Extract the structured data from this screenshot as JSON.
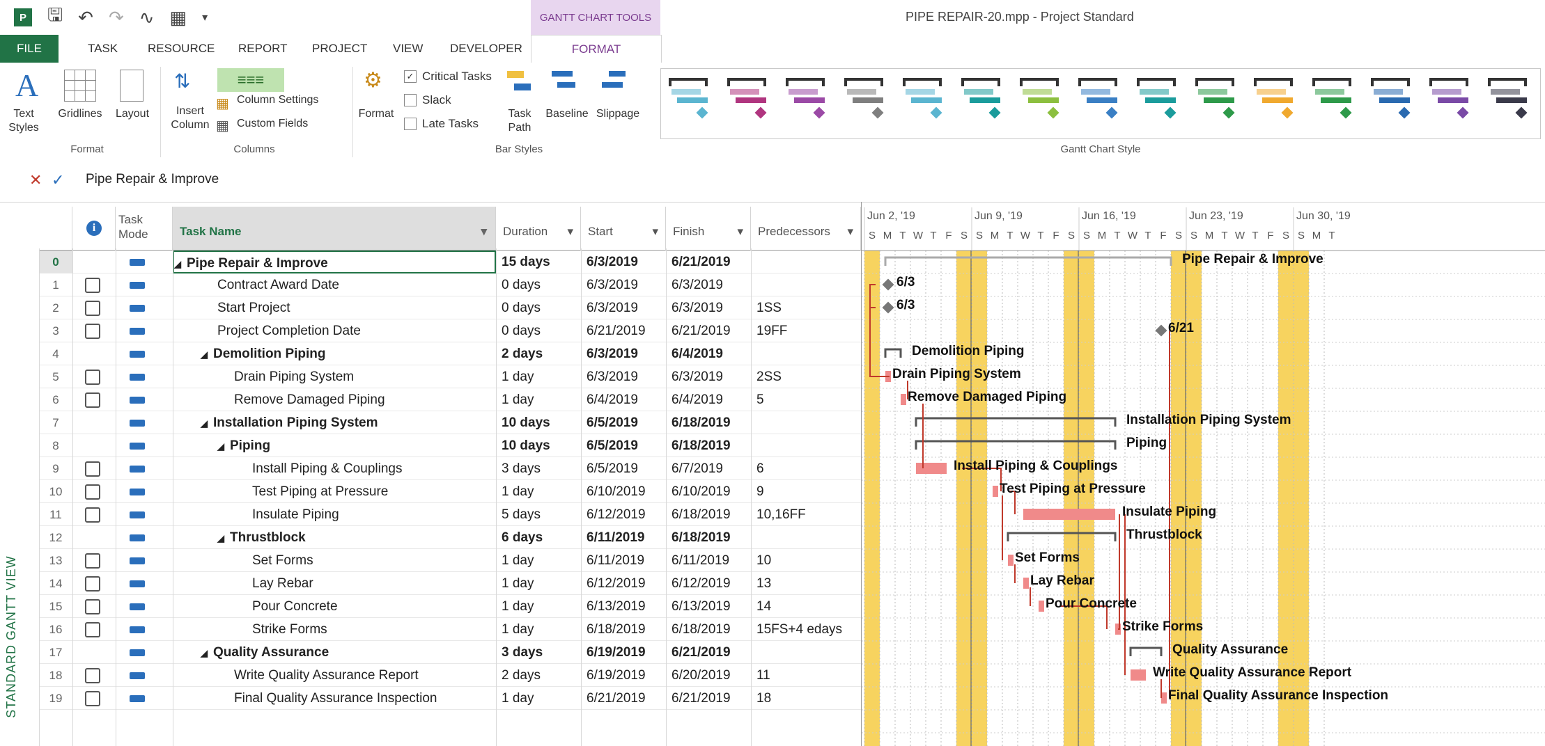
{
  "quick_access": {
    "undo_icon": "undo-icon",
    "redo_icon": "redo-icon"
  },
  "title": "PIPE REPAIR-20.mpp - Project Standard",
  "contextual_tab": "GANTT CHART TOOLS",
  "tabs": [
    "FILE",
    "TASK",
    "RESOURCE",
    "REPORT",
    "PROJECT",
    "VIEW",
    "DEVELOPER",
    "FORMAT"
  ],
  "ribbon": {
    "format_group": {
      "label": "Format",
      "text_styles": "Text Styles",
      "gridlines": "Gridlines",
      "layout": "Layout"
    },
    "columns_group": {
      "label": "Columns",
      "insert_column": "Insert Column",
      "column_settings": "Column Settings",
      "custom_fields": "Custom Fields"
    },
    "bar_styles_group": {
      "label": "Bar Styles",
      "format": "Format",
      "critical_tasks": "Critical Tasks",
      "slack": "Slack",
      "late_tasks": "Late Tasks",
      "critical_checked": true,
      "slack_checked": false,
      "late_checked": false,
      "task_path": "Task Path",
      "baseline": "Baseline",
      "slippage": "Slippage"
    },
    "gantt_style_group": {
      "label": "Gantt Chart Style",
      "colors": [
        "#5bb5d0",
        "#b0357f",
        "#9b4aa6",
        "#7f7f7f",
        "#5bb5d0",
        "#1b9c9c",
        "#8cbf3f",
        "#3a7fc4",
        "#1b9c9c",
        "#2e9a4a",
        "#f0a92f",
        "#2e9a4a",
        "#2a6ab0",
        "#7a4aa6",
        "#3a3a4a"
      ]
    }
  },
  "formula_bar": {
    "value": "Pipe Repair & Improve"
  },
  "view_label": "STANDARD GANTT VIEW",
  "columns": {
    "mode": "Task Mode",
    "name": "Task Name",
    "duration": "Duration",
    "start": "Start",
    "finish": "Finish",
    "pred": "Predecessors"
  },
  "tasks": [
    {
      "id": "0",
      "name": "Pipe Repair & Improve",
      "duration": "15 days",
      "start": "6/3/2019",
      "finish": "6/21/2019",
      "pred": "",
      "level": 0,
      "summary": true,
      "note": false
    },
    {
      "id": "1",
      "name": "Contract Award Date",
      "duration": "0 days",
      "start": "6/3/2019",
      "finish": "6/3/2019",
      "pred": "",
      "level": 1,
      "summary": false,
      "note": true
    },
    {
      "id": "2",
      "name": "Start Project",
      "duration": "0 days",
      "start": "6/3/2019",
      "finish": "6/3/2019",
      "pred": "1SS",
      "level": 1,
      "summary": false,
      "note": true
    },
    {
      "id": "3",
      "name": "Project Completion Date",
      "duration": "0 days",
      "start": "6/21/2019",
      "finish": "6/21/2019",
      "pred": "19FF",
      "level": 1,
      "summary": false,
      "note": true
    },
    {
      "id": "4",
      "name": "Demolition Piping",
      "duration": "2 days",
      "start": "6/3/2019",
      "finish": "6/4/2019",
      "pred": "",
      "level": 1,
      "summary": true,
      "note": false
    },
    {
      "id": "5",
      "name": "Drain Piping System",
      "duration": "1 day",
      "start": "6/3/2019",
      "finish": "6/3/2019",
      "pred": "2SS",
      "level": 2,
      "summary": false,
      "note": true
    },
    {
      "id": "6",
      "name": "Remove Damaged Piping",
      "duration": "1 day",
      "start": "6/4/2019",
      "finish": "6/4/2019",
      "pred": "5",
      "level": 2,
      "summary": false,
      "note": true
    },
    {
      "id": "7",
      "name": "Installation Piping System",
      "duration": "10 days",
      "start": "6/5/2019",
      "finish": "6/18/2019",
      "pred": "",
      "level": 1,
      "summary": true,
      "note": false
    },
    {
      "id": "8",
      "name": "Piping",
      "duration": "10 days",
      "start": "6/5/2019",
      "finish": "6/18/2019",
      "pred": "",
      "level": 2,
      "summary": true,
      "note": false
    },
    {
      "id": "9",
      "name": "Install Piping & Couplings",
      "duration": "3 days",
      "start": "6/5/2019",
      "finish": "6/7/2019",
      "pred": "6",
      "level": 3,
      "summary": false,
      "note": true
    },
    {
      "id": "10",
      "name": "Test Piping at Pressure",
      "duration": "1 day",
      "start": "6/10/2019",
      "finish": "6/10/2019",
      "pred": "9",
      "level": 3,
      "summary": false,
      "note": true
    },
    {
      "id": "11",
      "name": "Insulate Piping",
      "duration": "5 days",
      "start": "6/12/2019",
      "finish": "6/18/2019",
      "pred": "10,16FF",
      "level": 3,
      "summary": false,
      "note": true
    },
    {
      "id": "12",
      "name": "Thrustblock",
      "duration": "6 days",
      "start": "6/11/2019",
      "finish": "6/18/2019",
      "pred": "",
      "level": 2,
      "summary": true,
      "note": false
    },
    {
      "id": "13",
      "name": "Set Forms",
      "duration": "1 day",
      "start": "6/11/2019",
      "finish": "6/11/2019",
      "pred": "10",
      "level": 3,
      "summary": false,
      "note": true
    },
    {
      "id": "14",
      "name": "Lay Rebar",
      "duration": "1 day",
      "start": "6/12/2019",
      "finish": "6/12/2019",
      "pred": "13",
      "level": 3,
      "summary": false,
      "note": true
    },
    {
      "id": "15",
      "name": "Pour Concrete",
      "duration": "1 day",
      "start": "6/13/2019",
      "finish": "6/13/2019",
      "pred": "14",
      "level": 3,
      "summary": false,
      "note": true
    },
    {
      "id": "16",
      "name": "Strike Forms",
      "duration": "1 day",
      "start": "6/18/2019",
      "finish": "6/18/2019",
      "pred": "15FS+4 edays",
      "level": 3,
      "summary": false,
      "note": true
    },
    {
      "id": "17",
      "name": "Quality Assurance",
      "duration": "3 days",
      "start": "6/19/2019",
      "finish": "6/21/2019",
      "pred": "",
      "level": 1,
      "summary": true,
      "note": false
    },
    {
      "id": "18",
      "name": "Write Quality Assurance Report",
      "duration": "2 days",
      "start": "6/19/2019",
      "finish": "6/20/2019",
      "pred": "11",
      "level": 2,
      "summary": false,
      "note": true
    },
    {
      "id": "19",
      "name": "Final Quality Assurance Inspection",
      "duration": "1 day",
      "start": "6/21/2019",
      "finish": "6/21/2019",
      "pred": "18",
      "level": 2,
      "summary": false,
      "note": true
    }
  ],
  "timescale": {
    "weeks": [
      "Jun 2, '19",
      "Jun 9, '19",
      "Jun 16, '19",
      "Jun 23, '19",
      "Jun 30, '19"
    ],
    "days": [
      "S",
      "M",
      "T",
      "W",
      "T",
      "F",
      "S",
      "S",
      "M",
      "T",
      "W",
      "T",
      "F",
      "S",
      "S",
      "M",
      "T",
      "W",
      "T",
      "F",
      "S",
      "S",
      "M",
      "T",
      "W",
      "T",
      "F",
      "S",
      "S",
      "M",
      "T"
    ]
  },
  "gantt_labels": {
    "m1": "6/3",
    "m2": "6/3",
    "m3": "6/21"
  },
  "colors": {
    "accent": "#217346",
    "weekend": "#f7d35f",
    "task_bar": "#f08a8a",
    "link": "#c0392b",
    "summary": "#555555",
    "format_tab": "#7a3b8f"
  }
}
